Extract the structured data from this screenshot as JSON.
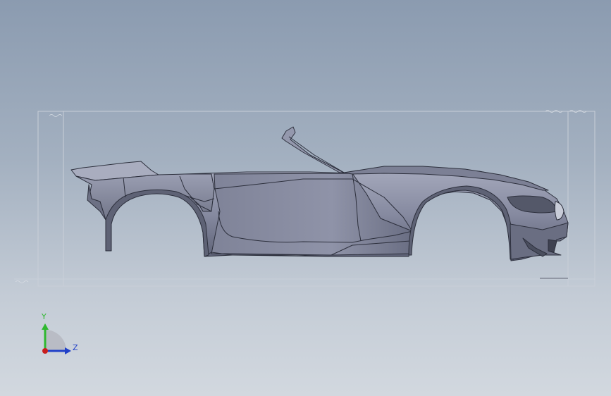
{
  "viewport": {
    "background_top": "#8b9bb0",
    "background_bottom": "#d2d8df"
  },
  "model": {
    "body_color": "#8a8fa3",
    "edge_color": "#2c2f3c"
  },
  "triad": {
    "y_label": "Y",
    "z_label": "Z",
    "y_color": "#2fb82f",
    "z_color": "#2040c8",
    "origin_color": "#c81e1e"
  }
}
